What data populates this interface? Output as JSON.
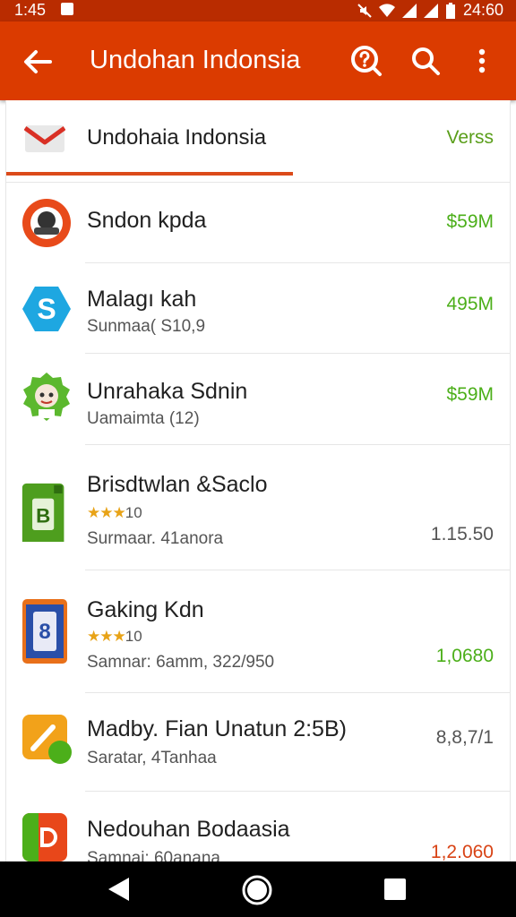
{
  "status_bar": {
    "time": "1:45",
    "clock": "24:60"
  },
  "app_bar": {
    "title": "Undohan Indonsia"
  },
  "tab": {
    "label": "Undohaia Indonsia",
    "version": "Verss"
  },
  "apps": [
    {
      "name": "Sndon kpda",
      "subtitle": "",
      "rating": "",
      "value": "$59M",
      "value_color": "#4caf1a",
      "icon": "camera-app-icon"
    },
    {
      "name": "Malagı kah",
      "subtitle": "Sunmaa( S10,9",
      "rating": "",
      "value": "495M",
      "value_color": "#4caf1a",
      "icon": "skype-app-icon"
    },
    {
      "name": "Unrahaka Sdnin",
      "subtitle": "Uamaimta (12)",
      "rating": "",
      "value": "$59M",
      "value_color": "#4caf1a",
      "icon": "character-badge-app-icon"
    },
    {
      "name": "Brisdtwlan &Saclo",
      "subtitle": "Surmaar. 41anora",
      "rating": "10",
      "value": "1.15.50",
      "value_color": "#555555",
      "icon": "green-book-app-icon"
    },
    {
      "name": "Gaking Kdn",
      "subtitle": "Samnar: 6amm, 322/950",
      "rating": "10",
      "value": "1,0680",
      "value_color": "#4caf1a",
      "icon": "phone-app-icon"
    },
    {
      "name": "Madby. Fian Unatun 2:5B)",
      "subtitle": "Saratar, 4Tanhaa",
      "rating": "",
      "value": "8,8,7/1",
      "value_color": "#555555",
      "icon": "pencil-app-icon"
    },
    {
      "name": "Nedouhan Bodaasia",
      "subtitle": "Samnai: 60anana",
      "rating": "",
      "value": "1,2.060",
      "value_color": "#d84315",
      "icon": "red-green-app-icon"
    }
  ],
  "colors": {
    "app_bar": "#db3b00",
    "status_bar": "#b92c00",
    "accent_green": "#4caf1a"
  }
}
